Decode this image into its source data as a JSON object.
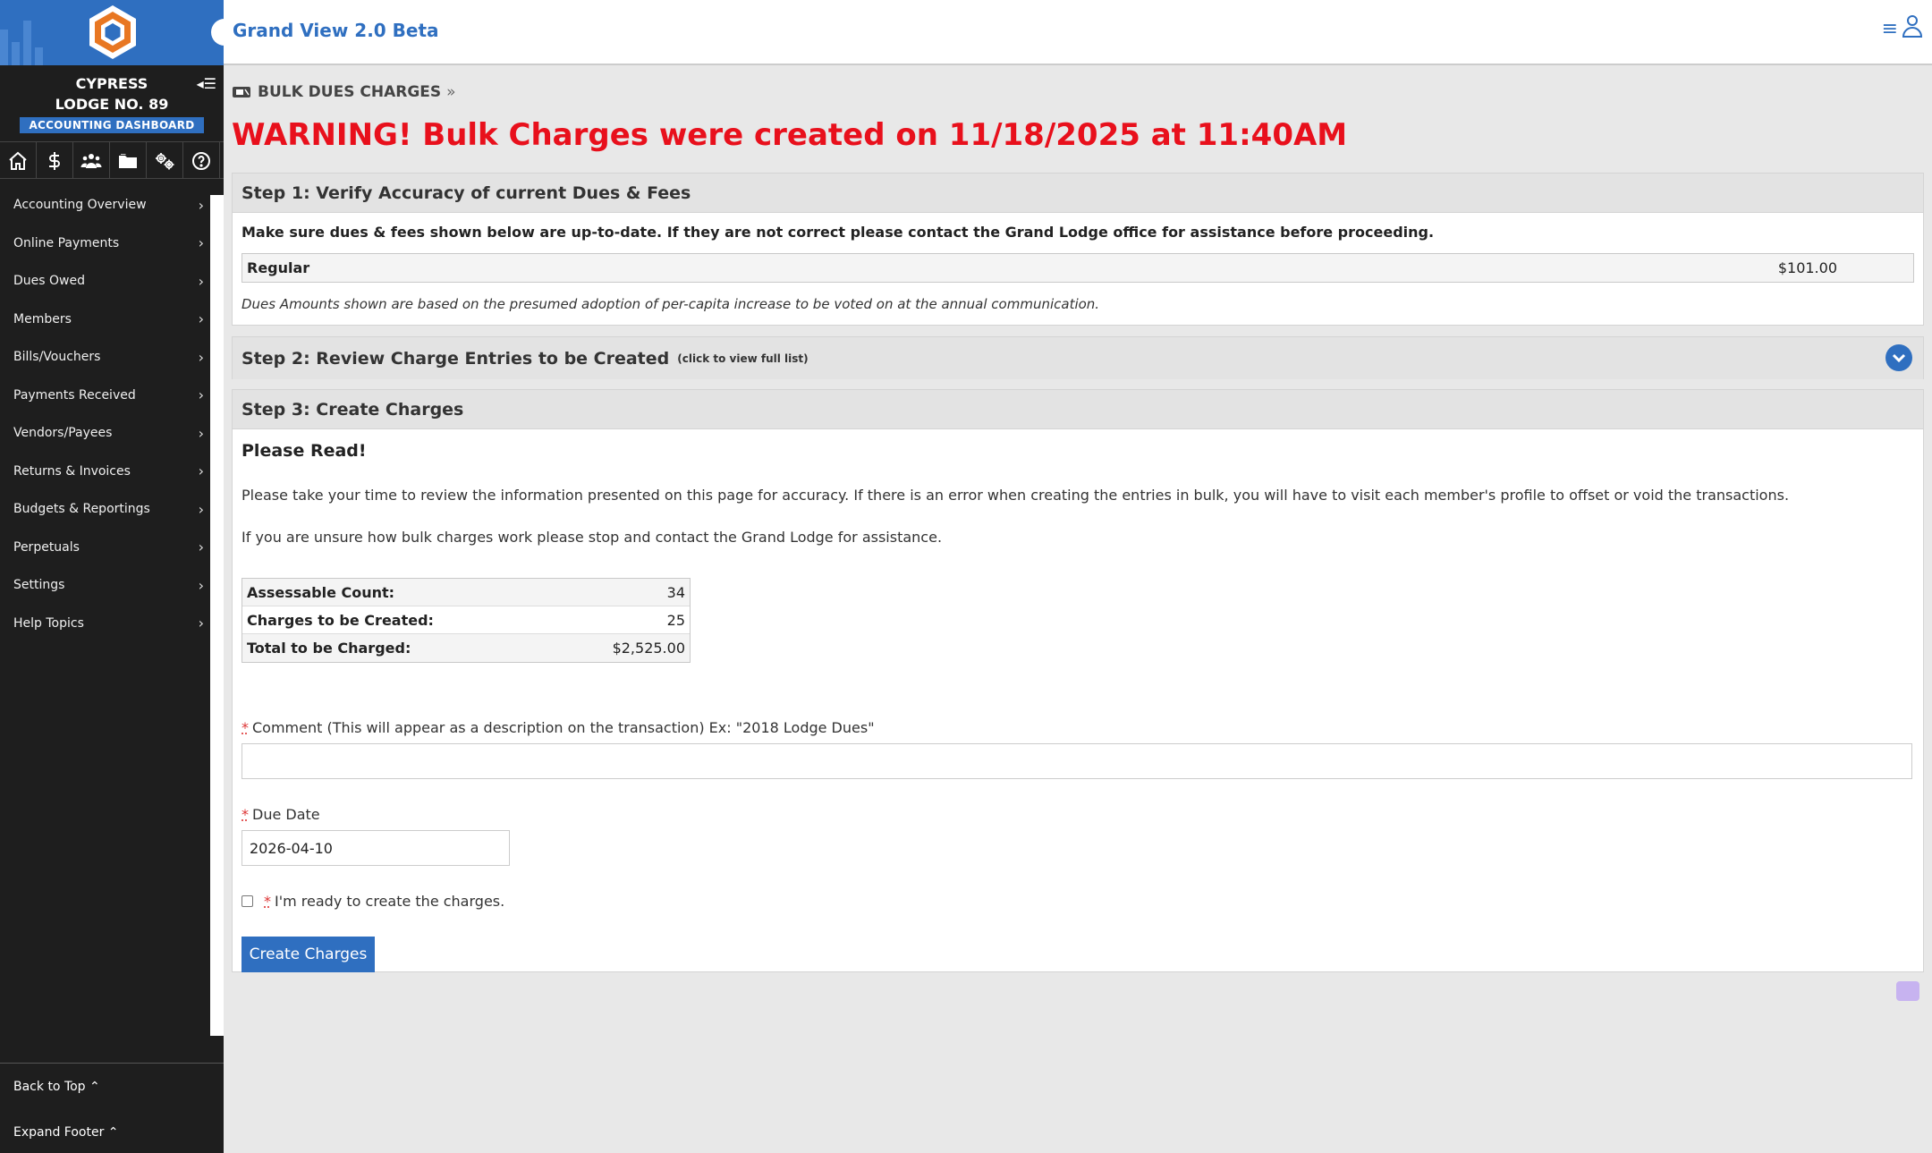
{
  "sidebar": {
    "lodge_line1": "CYPRESS",
    "lodge_line2": "LODGE NO. 89",
    "dashboard_badge": "ACCOUNTING DASHBOARD",
    "nav_items": [
      "Accounting Overview",
      "Online Payments",
      "Dues Owed",
      "Members",
      "Bills/Vouchers",
      "Payments Received",
      "Vendors/Payees",
      "Returns & Invoices",
      "Budgets & Reportings",
      "Perpetuals",
      "Settings",
      "Help Topics"
    ],
    "back_to_top": "Back to Top ⌃",
    "expand_footer": "Expand Footer ⌃"
  },
  "header": {
    "title": "Grand View 2.0 Beta"
  },
  "breadcrumb": {
    "label": "BULK DUES CHARGES",
    "separator": "»"
  },
  "warning": "WARNING! Bulk Charges were created on 11/18/2025 at 11:40AM",
  "step1": {
    "title": "Step 1: Verify Accuracy of current Dues & Fees",
    "intro": "Make sure dues & fees shown below are up-to-date. If they are not correct please contact the Grand Lodge office for assistance before proceeding.",
    "dues_label": "Regular",
    "dues_amount": "$101.00",
    "note": "Dues Amounts shown are based on the presumed adoption of per-capita increase to be voted on at the annual communication."
  },
  "step2": {
    "title": "Step 2: Review Charge Entries to be Created",
    "hint": "(click to view full list)"
  },
  "step3": {
    "title": "Step 3: Create Charges",
    "please_read": "Please Read!",
    "para1": "Please take your time to review the information presented on this page for accuracy. If there is an error when creating the entries in bulk, you will have to visit each member's profile to offset or void the transactions.",
    "para2": "If you are unsure how bulk charges work please stop and contact the Grand Lodge for assistance.",
    "stats": [
      {
        "label": "Assessable Count:",
        "value": "34"
      },
      {
        "label": "Charges to be Created:",
        "value": "25"
      },
      {
        "label": "Total to be Charged:",
        "value": "$2,525.00"
      }
    ],
    "required_mark": "*",
    "comment_label": "Comment (This will appear as a description on the transaction) Ex: \"2018 Lodge Dues\"",
    "comment_value": "",
    "due_date_label": "Due Date",
    "due_date_value": "2026-04-10",
    "ready_label": "I'm ready to create the charges.",
    "button_label": "Create Charges"
  },
  "colors": {
    "brand_blue": "#2f6fc0",
    "warning_red": "#e8101c",
    "sidebar_bg": "#1e1e1e"
  }
}
